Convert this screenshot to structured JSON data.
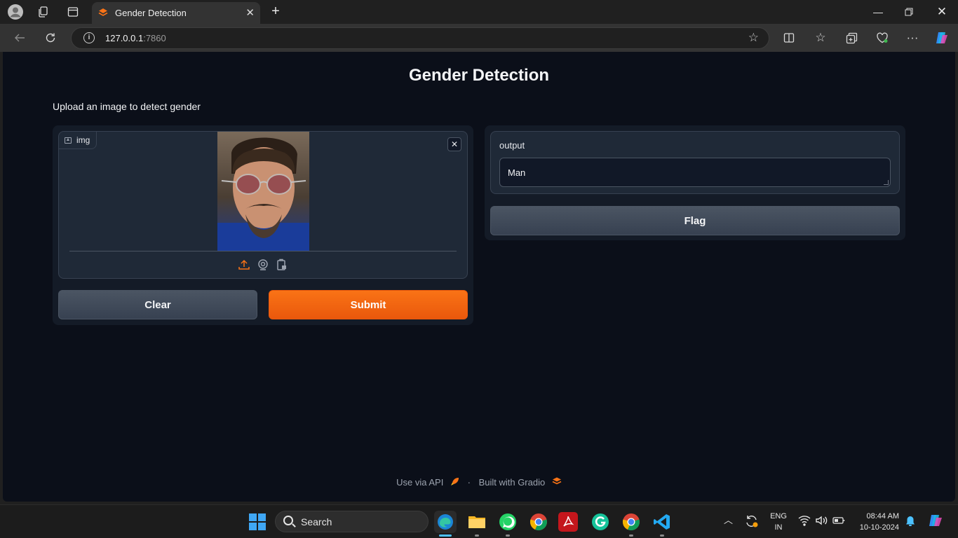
{
  "browser": {
    "tab_title": "Gender Detection",
    "url_host": "127.0.0.1",
    "url_port": ":7860"
  },
  "page": {
    "title": "Gender Detection",
    "description": "Upload an image to detect gender"
  },
  "input_image": {
    "label": "img"
  },
  "buttons": {
    "clear": "Clear",
    "submit": "Submit",
    "flag": "Flag"
  },
  "output": {
    "label": "output",
    "value": "Man"
  },
  "footer": {
    "api_link": "Use via API",
    "separator": "·",
    "built_with": "Built with Gradio"
  },
  "taskbar": {
    "search_label": "Search",
    "language_top": "ENG",
    "language_bottom": "IN",
    "time": "08:44 AM",
    "date": "10-10-2024"
  },
  "colors": {
    "page_bg": "#0b0f19",
    "panel_bg": "#1f2937",
    "accent": "#f97316"
  }
}
